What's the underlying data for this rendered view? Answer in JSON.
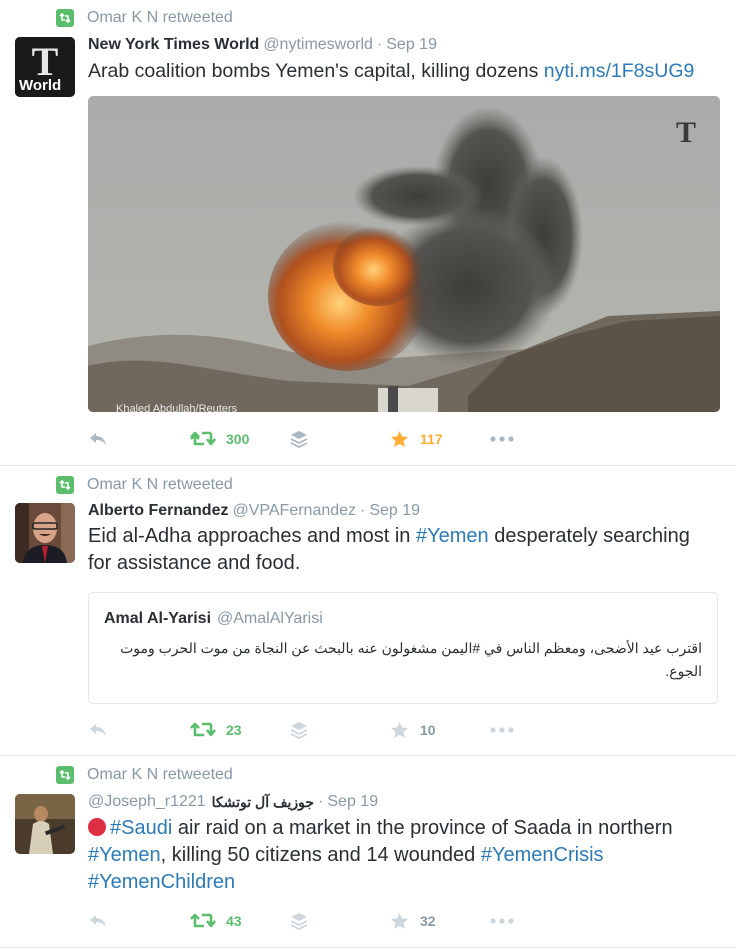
{
  "tweets": [
    {
      "retweeted_by": "Omar K N retweeted",
      "name": "New York Times World",
      "handle": "@nytimesworld",
      "dot": "·",
      "time": "Sep 19",
      "avatar_label": "World",
      "text": "Arab coalition bombs Yemen's capital, killing dozens ",
      "link": "nyti.ms/1F8sUG9",
      "photo_credit": "Khaled Abdullah/Reuters",
      "retweets": "300",
      "favorites": "117",
      "favorited": true
    },
    {
      "retweeted_by": "Omar K N retweeted",
      "name": "Alberto Fernandez",
      "handle": "@VPAFernandez",
      "dot": "·",
      "time": "Sep 19",
      "text_before": "Eid al-Adha approaches and most in ",
      "hashtag": "#Yemen",
      "text_after": " desperately searching for assistance and food.",
      "quote": {
        "name": "Amal Al-Yarisi",
        "handle": "@AmalAlYarisi",
        "text": "اقترب عيد الأضحى، ومعظم الناس في #اليمن مشغولون عنه بالبحث عن النجاة من موت الحرب وموت الجوع."
      },
      "retweets": "23",
      "favorites": "10",
      "favorited": false
    },
    {
      "retweeted_by": "Omar K N retweeted",
      "name": "جوزيف آل توتشكا",
      "handle": "@Joseph_r1221",
      "dot": "·",
      "time": "Sep 19",
      "tag1": "#Saudi",
      "text1": " air raid on a market in the province of Saada in northern ",
      "tag2": "#Yemen",
      "text2": ", killing 50 citizens and 14 wounded ",
      "tag3": "#YemenCrisis",
      "tag4": "#YemenChildren",
      "retweets": "43",
      "favorites": "32",
      "favorited": false
    }
  ],
  "icons": [
    "retweet-icon",
    "reply-icon",
    "buffer-icon",
    "star-icon",
    "more-icon",
    "red-circle-emoji"
  ],
  "colors": {
    "retweet_green": "#5cbe6d",
    "favorite_gold": "#ffac33",
    "link_blue": "#2b7bb9",
    "meta_grey": "#8899a6"
  }
}
